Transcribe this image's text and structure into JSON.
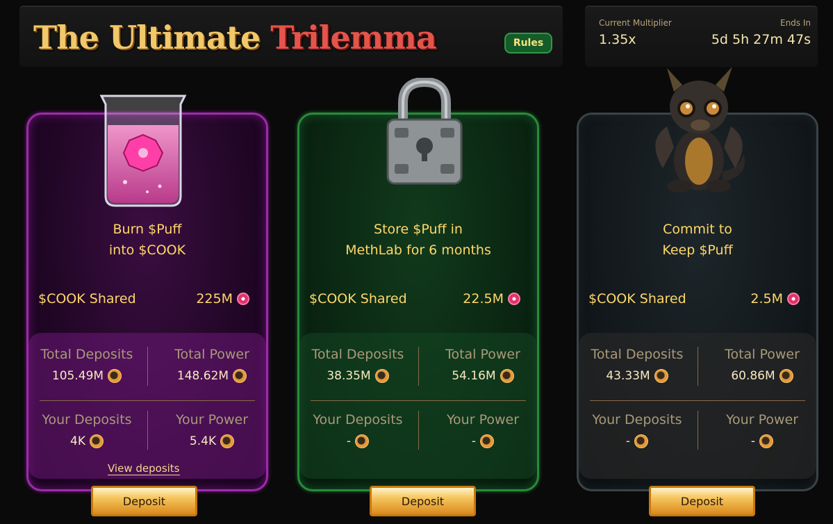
{
  "header": {
    "title_part1": "The Ultimate",
    "title_part2": "Trilemma",
    "rules_label": "Rules"
  },
  "info": {
    "multiplier_label": "Current Multiplier",
    "multiplier_value": "1.35x",
    "ends_label": "Ends In",
    "ends_value": "5d 5h 27m 47s"
  },
  "cards": [
    {
      "title_line1": "Burn $Puff",
      "title_line2": "into $COOK",
      "shared_label": "$COOK Shared",
      "shared_value": "225M",
      "total_deposits_label": "Total Deposits",
      "total_deposits_value": "105.49M",
      "total_power_label": "Total Power",
      "total_power_value": "148.62M",
      "your_deposits_label": "Your Deposits",
      "your_deposits_value": "4K",
      "your_power_label": "Your Power",
      "your_power_value": "5.4K",
      "view_deposits_label": "View deposits",
      "deposit_label": "Deposit"
    },
    {
      "title_line1": "Store $Puff in",
      "title_line2": "MethLab for 6 months",
      "shared_label": "$COOK Shared",
      "shared_value": "22.5M",
      "total_deposits_label": "Total Deposits",
      "total_deposits_value": "38.35M",
      "total_power_label": "Total Power",
      "total_power_value": "54.16M",
      "your_deposits_label": "Your Deposits",
      "your_deposits_value": "-",
      "your_power_label": "Your Power",
      "your_power_value": "-",
      "deposit_label": "Deposit"
    },
    {
      "title_line1": "Commit to",
      "title_line2": "Keep $Puff",
      "shared_label": "$COOK Shared",
      "shared_value": "2.5M",
      "total_deposits_label": "Total Deposits",
      "total_deposits_value": "43.33M",
      "total_power_label": "Total Power",
      "total_power_value": "60.86M",
      "your_deposits_label": "Your Deposits",
      "your_deposits_value": "-",
      "your_power_label": "Your Power",
      "your_power_value": "-",
      "deposit_label": "Deposit"
    }
  ],
  "icons": {
    "cook_token": "cook-token-icon",
    "puff_token": "puff-token-icon"
  },
  "colors": {
    "gold_text": "#ffd76a",
    "card1_border": "#9b2ca8",
    "card2_border": "#2a8a3a",
    "card3_border": "#3a4448",
    "rules_bg": "#145c2a"
  }
}
